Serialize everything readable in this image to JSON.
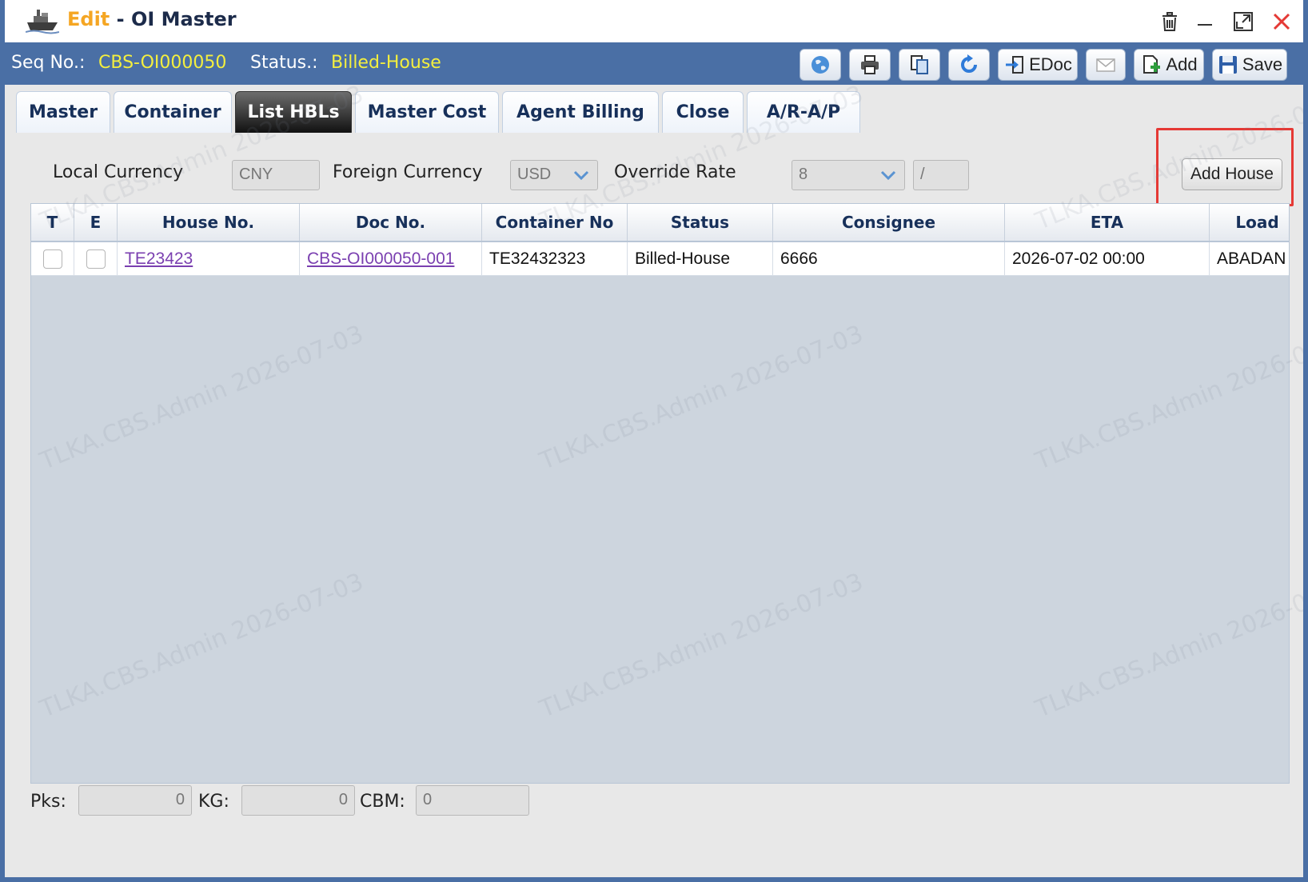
{
  "window": {
    "edit_label": "Edit",
    "separator": " - ",
    "title": "OI Master"
  },
  "header": {
    "seq_label": "Seq No.:",
    "seq_value": "CBS-OI000050",
    "status_label": "Status.:",
    "status_value": "Billed-House",
    "edoc_label": "EDoc",
    "add_label": "Add",
    "save_label": "Save"
  },
  "tabs": [
    {
      "label": "Master"
    },
    {
      "label": "Container"
    },
    {
      "label": "List HBLs",
      "active": true
    },
    {
      "label": "Master Cost"
    },
    {
      "label": "Agent Billing"
    },
    {
      "label": "Close"
    },
    {
      "label": "A/R-A/P"
    }
  ],
  "filters": {
    "local_currency_label": "Local Currency",
    "local_currency_value": "CNY",
    "foreign_currency_label": "Foreign Currency",
    "foreign_currency_value": "USD",
    "override_rate_label": "Override Rate",
    "override_rate_value": "8",
    "override_rate_divider": "/",
    "add_house_label": "Add House"
  },
  "grid": {
    "columns": [
      "T",
      "E",
      "House No.",
      "Doc No.",
      "Container No",
      "Status",
      "Consignee",
      "ETA",
      "Load"
    ],
    "rows": [
      {
        "house_no": "TE23423",
        "doc_no": "CBS-OI000050-001",
        "container_no": "TE32432323",
        "status": "Billed-House",
        "consignee": "6666",
        "eta": "2026-07-02 00:00",
        "load": "ABADAN"
      }
    ]
  },
  "footer": {
    "pks_label": "Pks:",
    "pks_value": "0",
    "kg_label": "KG:",
    "kg_value": "0",
    "cbm_label": "CBM:",
    "cbm_value": "0"
  },
  "watermark": "TLKA.CBS.Admin 2026-07-03",
  "colors": {
    "accent": "#4a6fa5",
    "status_yellow": "#f4ef3e",
    "edit_orange": "#f5a623",
    "highlight_red": "#e53935",
    "link_purple": "#7a3fb0"
  }
}
